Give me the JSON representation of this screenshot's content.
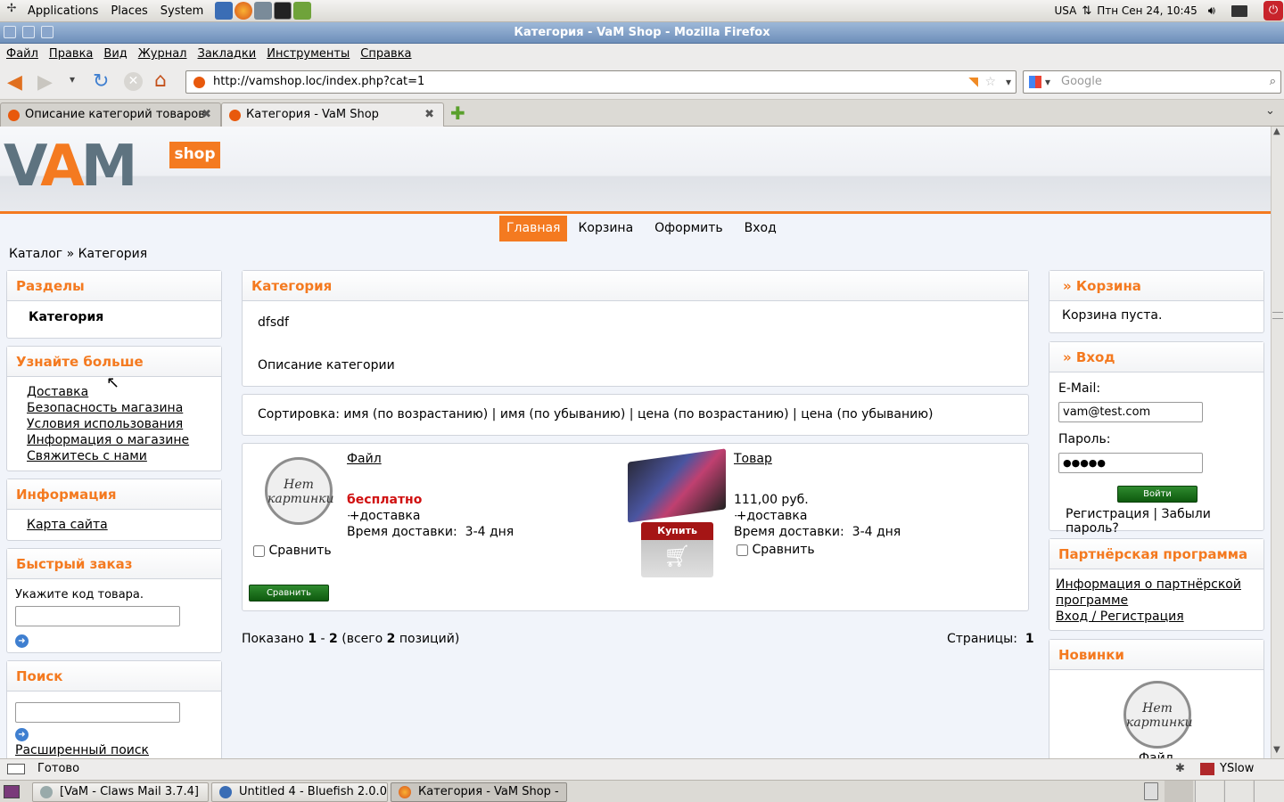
{
  "top_panel": {
    "menus": [
      "Applications",
      "Places",
      "System"
    ],
    "locale": "USA",
    "datetime": "Птн Сен 24, 10:45"
  },
  "window": {
    "title": "Категория - VaM Shop - Mozilla Firefox"
  },
  "menubar": [
    "Файл",
    "Правка",
    "Вид",
    "Журнал",
    "Закладки",
    "Инструменты",
    "Справка"
  ],
  "navbar": {
    "url": "http://vamshop.loc/index.php?cat=1",
    "search_placeholder": "Google"
  },
  "tabs": [
    {
      "label": "Описание категорий товаров"
    },
    {
      "label": "Категория - VaM Shop"
    }
  ],
  "site": {
    "logo_main": "VAM",
    "logo_badge": "shop",
    "nav": [
      "Главная",
      "Корзина",
      "Оформить",
      "Вход"
    ],
    "breadcrumb": "Каталог » Категория"
  },
  "left": {
    "sections_title": "Разделы",
    "sections_item": "Категория",
    "learn_title": "Узнайте больше",
    "learn_links": [
      "Доставка",
      "Безопасность магазина",
      "Условия использования",
      "Информация о магазине",
      "Свяжитесь с нами"
    ],
    "info_title": "Информация",
    "info_link": "Карта сайта",
    "quick_title": "Быстрый заказ",
    "quick_label": "Укажите код товара.",
    "search_title": "Поиск",
    "search_advanced": "Расширенный поиск"
  },
  "main": {
    "category_title": "Категория",
    "category_name": "dfsdf",
    "category_desc": "Описание категории",
    "sort_label": "Сортировка:",
    "sort_links": [
      "имя (по возрастанию)",
      "имя (по убыванию)",
      "цена (по возрастанию)",
      "цена (по убыванию)"
    ],
    "no_image": "Нет картинки",
    "products": [
      {
        "name": "Файл",
        "price": "бесплатно",
        "shipping": "+доставка",
        "delivery_label": "Время доставки:",
        "delivery": "3-4 дня",
        "compare": "Сравнить"
      },
      {
        "name": "Товар",
        "price": "111,00 руб.",
        "shipping": "+доставка",
        "delivery_label": "Время доставки:",
        "delivery": "3-4 дня",
        "compare": "Сравнить",
        "buy": "Купить"
      }
    ],
    "compare_button": "Сравнить",
    "shown_prefix": "Показано",
    "shown_from": "1",
    "shown_dash": "-",
    "shown_to": "2",
    "shown_total_prefix": "(всего",
    "shown_total": "2",
    "shown_suffix": "позиций)",
    "pages_label": "Страницы:",
    "pages_value": "1"
  },
  "right": {
    "cart_title": "» Корзина",
    "cart_empty": "Корзина пуста.",
    "login_title": "» Вход",
    "email_label": "E-Mail:",
    "email_value": "vam@test.com",
    "password_label": "Пароль:",
    "password_value": "●●●●●",
    "login_button": "Войти",
    "register_link": "Регистрация",
    "forgot_link": "Забыли пароль?",
    "partner_title": "Партнёрская программа",
    "partner_info": "Информация о партнёрской программе",
    "partner_login": "Вход / Регистрация",
    "new_title": "Новинки",
    "new_item": "Файл"
  },
  "statusbar": {
    "status": "Готово",
    "addon": "YSlow"
  },
  "taskbar": [
    {
      "label": "[VaM - Claws Mail 3.7.4]"
    },
    {
      "label": "Untitled 4 - Bluefish 2.0.0"
    },
    {
      "label": "Категория - VaM Shop - ..."
    }
  ],
  "colors": {
    "accent": "#f47a20",
    "price_free": "#d01010",
    "titlebar": "#7f9cc4"
  }
}
